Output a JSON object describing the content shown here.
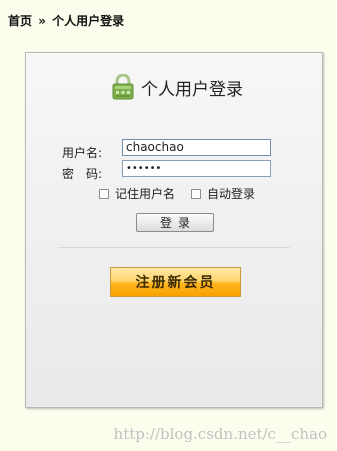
{
  "breadcrumb": {
    "home": "首页",
    "separator": "»",
    "current": "个人用户登录"
  },
  "login_panel": {
    "title": "个人用户登录",
    "title_icon": "lock-icon",
    "username_label": "用户名:",
    "username_value": "chaochao",
    "password_label": "密　码:",
    "password_mask": "••••••",
    "remember_username_label": "记住用户名",
    "auto_login_label": "自动登录",
    "login_button": "登录",
    "register_button": "注册新会员"
  },
  "watermark": "http://blog.csdn.net/c__chao",
  "colors": {
    "background": "#fdfdee",
    "register_button": "#ffc335",
    "input_border": "#8aa0b8"
  }
}
